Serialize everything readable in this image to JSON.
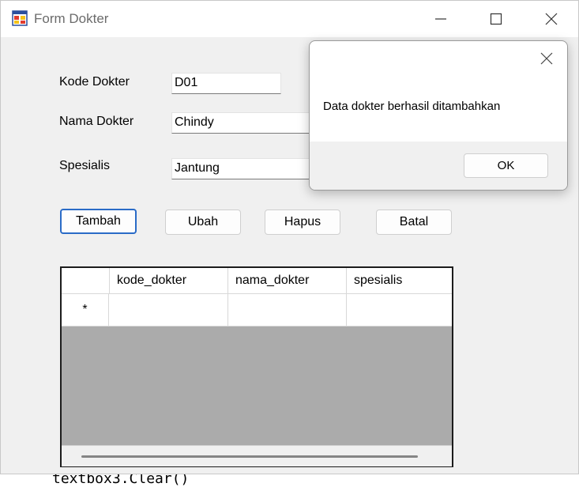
{
  "window": {
    "title": "Form Dokter",
    "icon": "form-app-icon"
  },
  "form": {
    "kode_label": "Kode Dokter",
    "kode_value": "D01",
    "nama_label": "Nama Dokter",
    "nama_value": "Chindy",
    "spesialis_label": "Spesialis",
    "spesialis_value": "Jantung"
  },
  "buttons": {
    "tambah": "Tambah",
    "ubah": "Ubah",
    "hapus": "Hapus",
    "batal": "Batal"
  },
  "grid": {
    "columns": [
      "kode_dokter",
      "nama_dokter",
      "spesialis"
    ],
    "new_row_marker": "*"
  },
  "background_code": "textbox3.Clear()",
  "dialog": {
    "message": "Data dokter berhasil ditambahkan",
    "ok_label": "OK"
  },
  "colors": {
    "focus_border": "#2a6bc7",
    "grid_empty": "#ababab"
  }
}
